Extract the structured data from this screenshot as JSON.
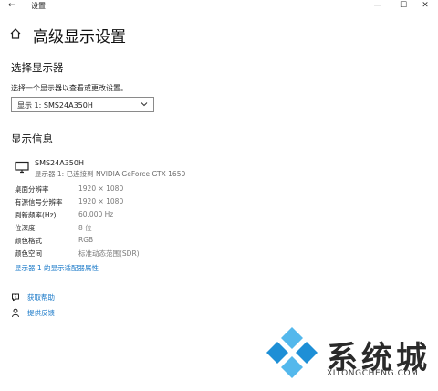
{
  "window": {
    "back_glyph": "←",
    "title": "设置",
    "minimize_glyph": "—",
    "maximize_glyph": "☐",
    "close_glyph": "✕"
  },
  "page": {
    "title": "高级显示设置"
  },
  "select_section": {
    "title": "选择显示器",
    "label": "选择一个显示器以查看或更改设置。",
    "dropdown_value": "显示 1: SMS24A350H"
  },
  "info_section": {
    "title": "显示信息",
    "monitor_name": "SMS24A350H",
    "monitor_connection": "显示器 1: 已连接到 NVIDIA GeForce GTX 1650",
    "rows": [
      {
        "label": "桌面分辨率",
        "value": "1920 × 1080"
      },
      {
        "label": "有源信号分辨率",
        "value": "1920 × 1080"
      },
      {
        "label": "刷新频率(Hz)",
        "value": "60.000 Hz"
      },
      {
        "label": "位深度",
        "value": "8 位"
      },
      {
        "label": "颜色格式",
        "value": "RGB"
      },
      {
        "label": "颜色空间",
        "value": "标准动态范围(SDR)"
      }
    ],
    "adapter_link": "显示器 1 的显示适配器属性"
  },
  "help": {
    "get_help": "获取帮助",
    "feedback": "提供反馈"
  },
  "watermark": {
    "brand": "系统城",
    "domain": "XITONGCHENG.COM"
  },
  "colors": {
    "link": "#1a79c8",
    "watermark_blue": "#1e8fd6",
    "watermark_light_blue": "#54b8ec"
  }
}
